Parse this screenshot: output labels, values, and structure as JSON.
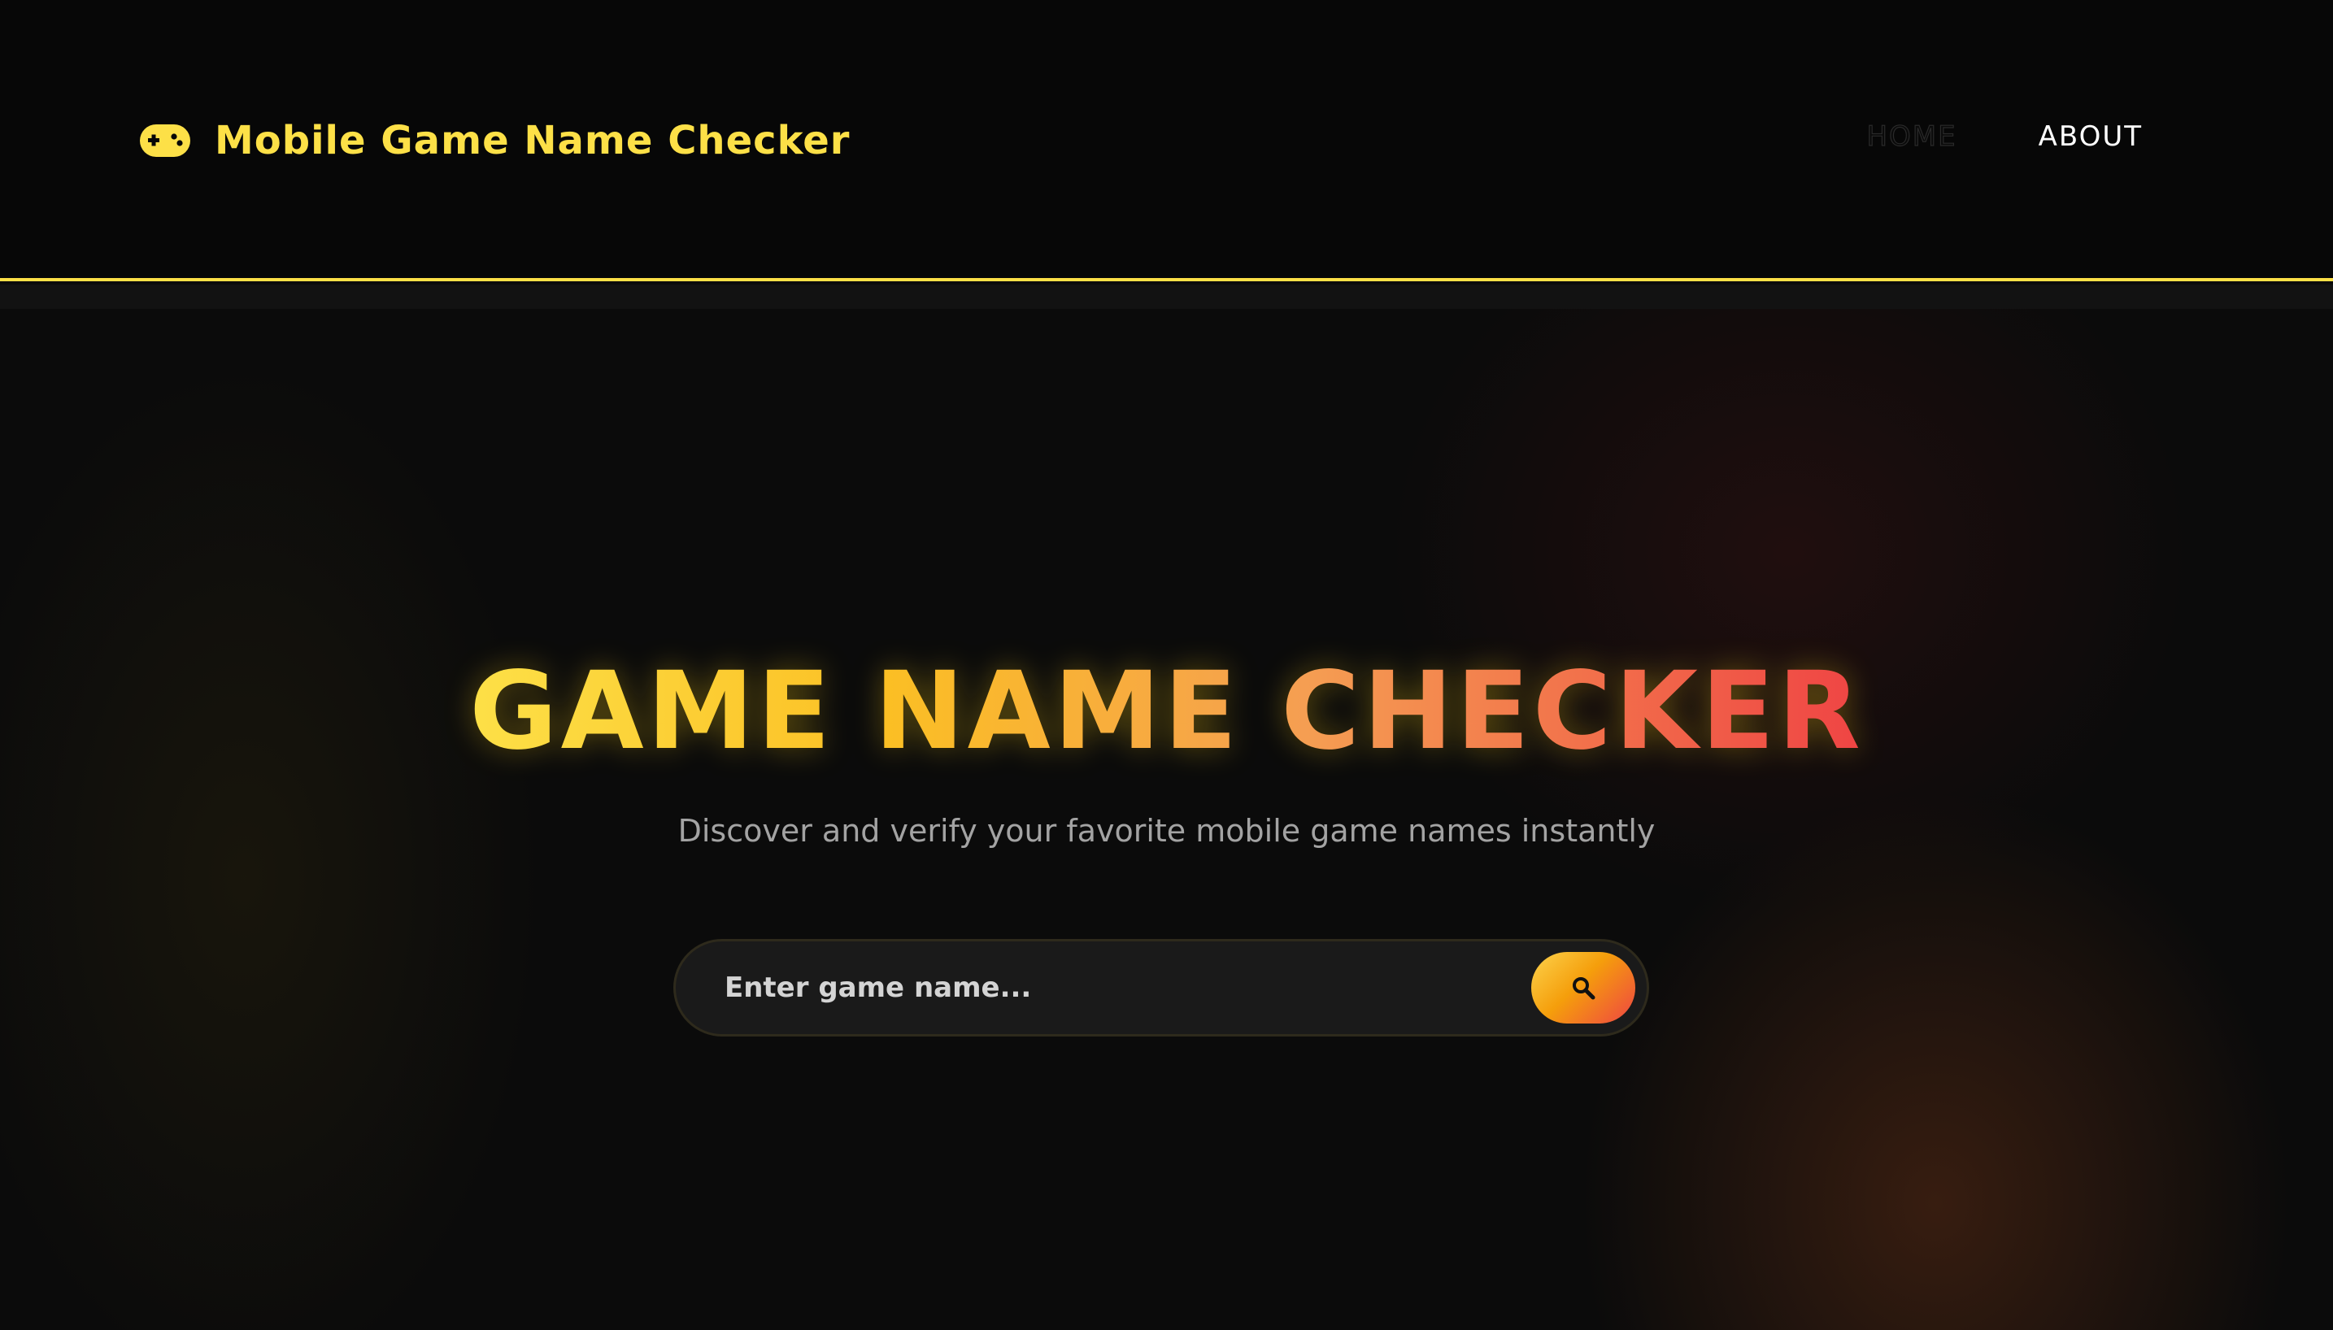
{
  "header": {
    "brand_title": "Mobile Game Name Checker",
    "brand_icon": "gamepad-icon",
    "nav": [
      {
        "label": "HOME"
      },
      {
        "label": "ABOUT"
      }
    ]
  },
  "hero": {
    "title": "GAME NAME CHECKER",
    "subtitle": "Discover and verify your favorite mobile game names instantly"
  },
  "search": {
    "placeholder": "Enter game name...",
    "button_icon": "search-icon"
  },
  "colors": {
    "accent": "#fde047",
    "gradient_start": "#fde047",
    "gradient_end": "#ef4444",
    "background": "#0b0b0b"
  }
}
